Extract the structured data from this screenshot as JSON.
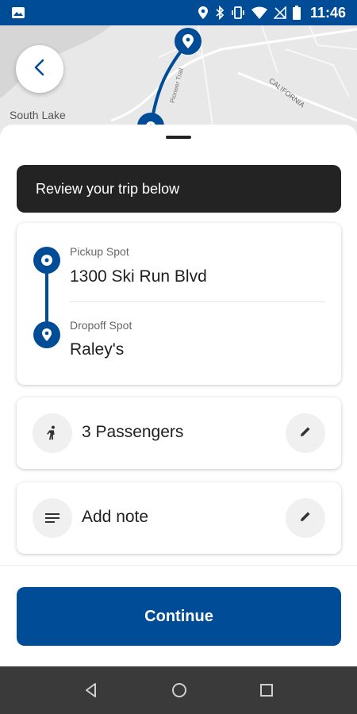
{
  "status_bar": {
    "time": "11:46",
    "icons": [
      "image-icon",
      "location-icon",
      "bluetooth-icon",
      "vibrate-icon",
      "wifi-icon",
      "no-signal-icon",
      "battery-icon"
    ]
  },
  "map": {
    "label_south_lake": "South Lake",
    "road_label_1": "Pioneer Trail",
    "road_label_2": "CALIFORNIA"
  },
  "sheet": {
    "banner": "Review your trip below",
    "trip": {
      "pickup_label": "Pickup Spot",
      "pickup_value": "1300 Ski Run Blvd",
      "dropoff_label": "Dropoff Spot",
      "dropoff_value": "Raley's"
    },
    "passengers": {
      "text": "3 Passengers"
    },
    "note": {
      "text": "Add note"
    },
    "continue_label": "Continue"
  },
  "colors": {
    "brand": "#004c97",
    "banner_bg": "#232323",
    "nav_bg": "#3a3a3a",
    "map_bg": "#e6e6e6"
  }
}
